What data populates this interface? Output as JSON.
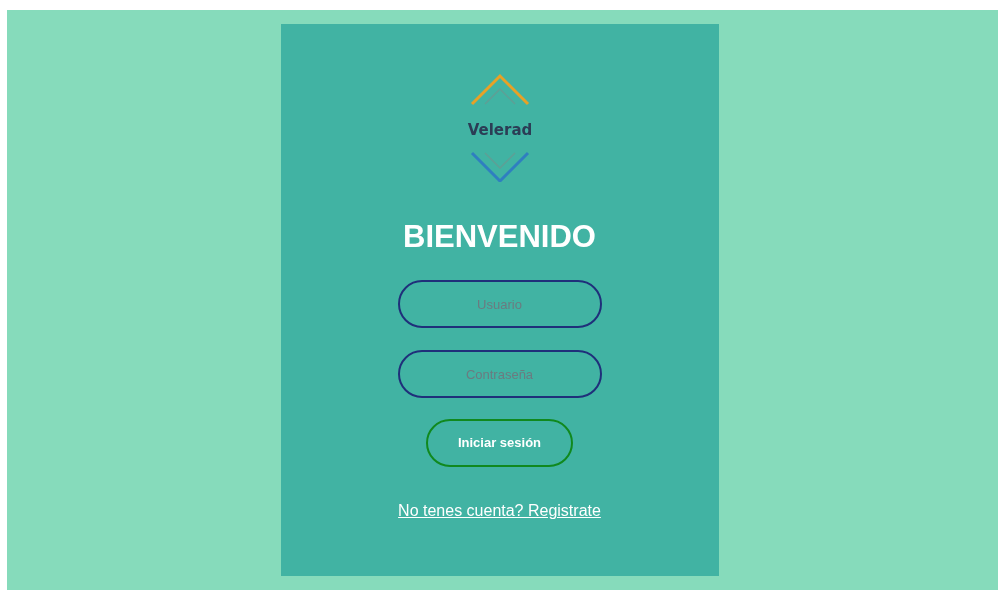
{
  "logo": {
    "text": "Velerad"
  },
  "title": "BIENVENIDO",
  "fields": [
    {
      "placeholder": "Usuario"
    },
    {
      "placeholder": "Contraseña"
    }
  ],
  "submit": "Iniciar sesión",
  "register_link": "No tenes cuenta? Registrate"
}
